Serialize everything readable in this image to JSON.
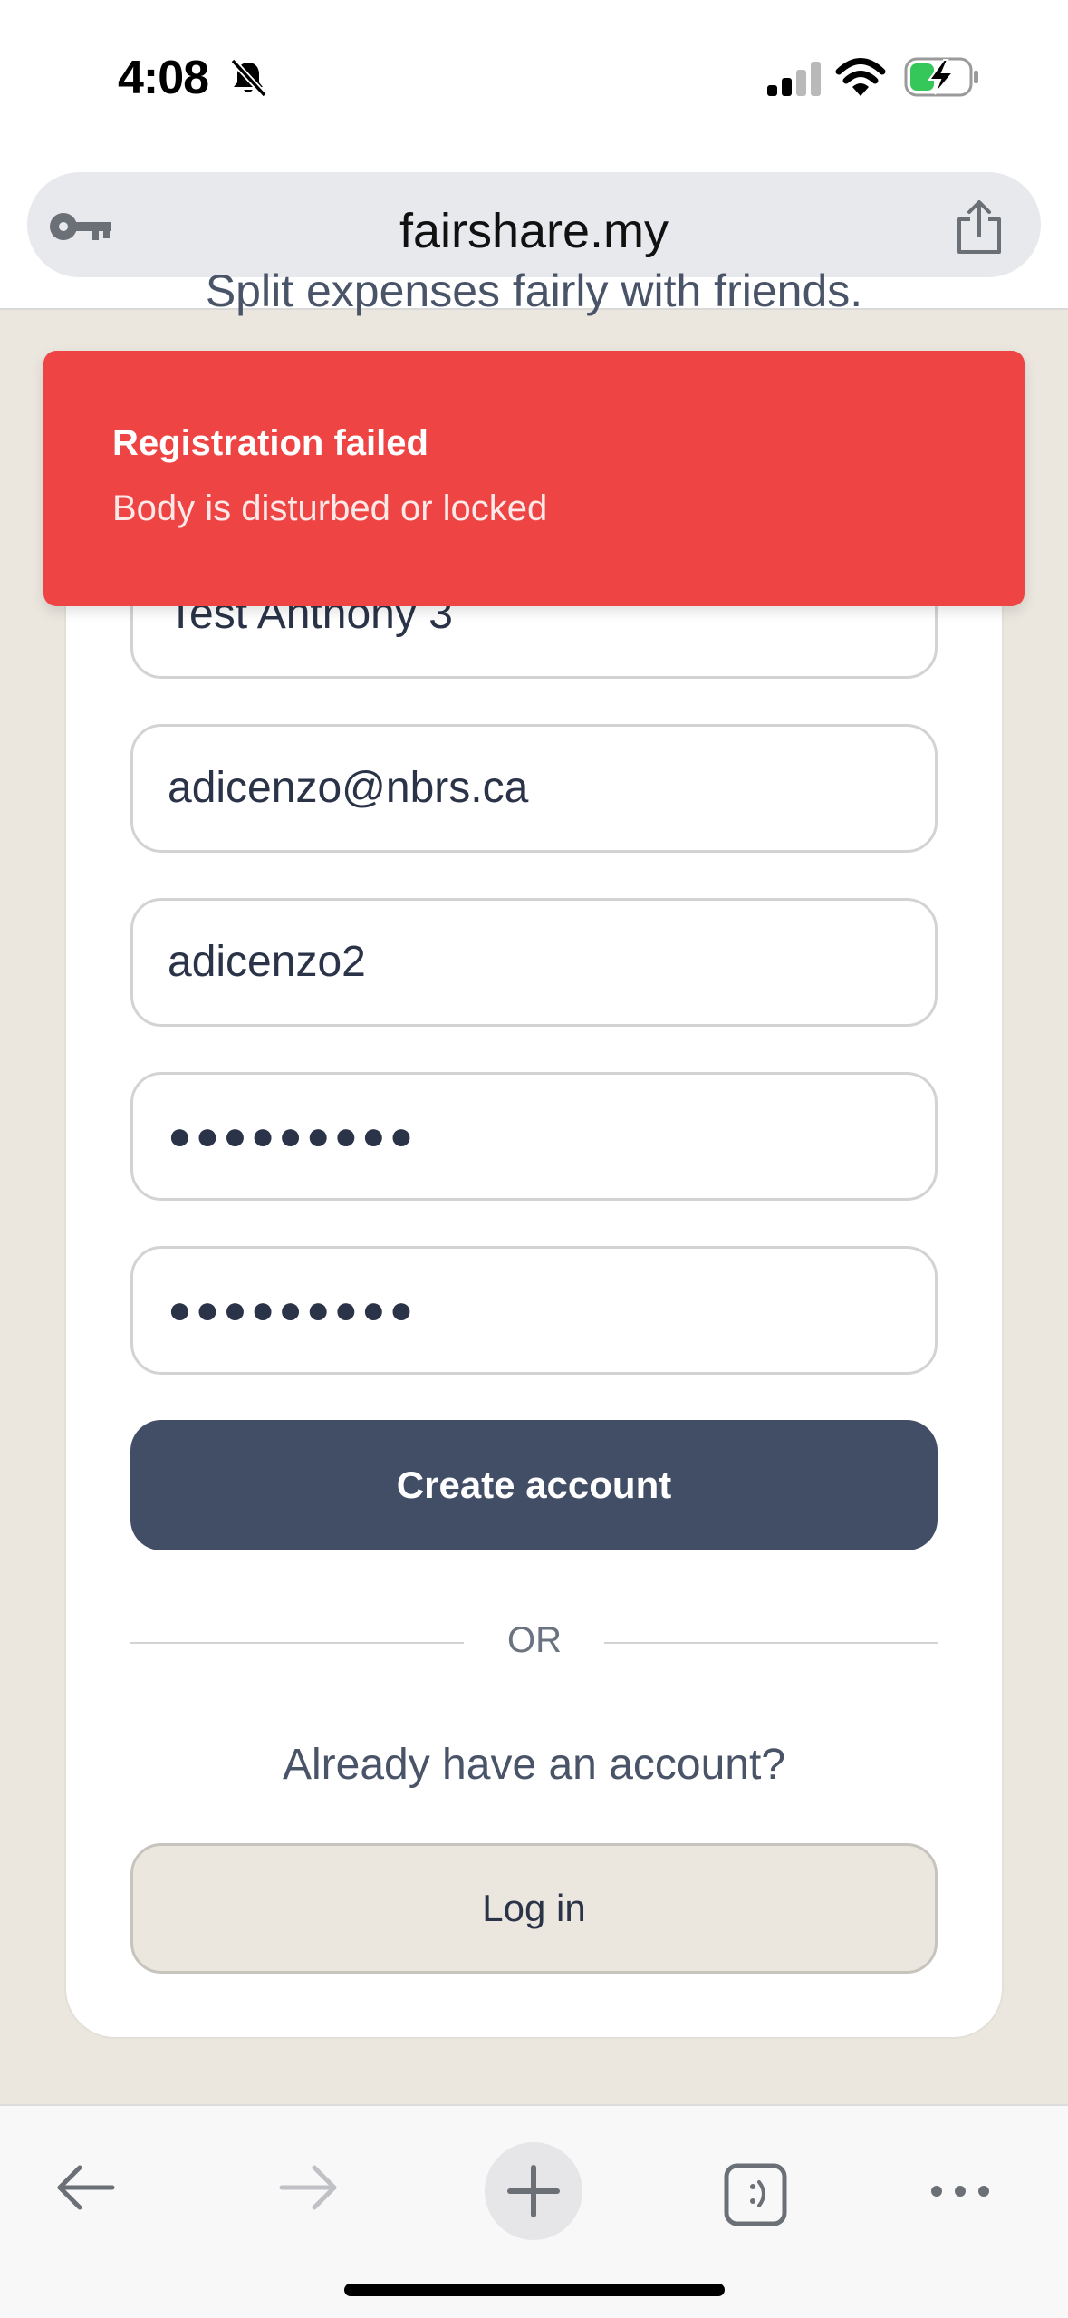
{
  "status_bar": {
    "time": "4:08",
    "icons": [
      "bell-slash-icon",
      "signal-icon",
      "wifi-icon",
      "battery-charging-icon"
    ]
  },
  "browser": {
    "url": "fairshare.my",
    "icons": [
      "key-icon",
      "share-icon"
    ]
  },
  "page": {
    "tagline": "Split expenses fairly with friends.",
    "form": {
      "name_value": "Test Anthony 3",
      "email_value": "adicenzo@nbrs.ca",
      "username_value": "adicenzo2",
      "password_value": "●●●●●●●●●",
      "confirm_password_value": "●●●●●●●●●",
      "create_account_label": "Create account",
      "or_label": "OR",
      "already_text": "Already have an account?",
      "login_label": "Log in"
    }
  },
  "toast": {
    "title": "Registration failed",
    "message": "Body is disturbed or locked",
    "color": "#ef4444"
  },
  "toolbar": {
    "icons": [
      "back-arrow-icon",
      "forward-arrow-icon",
      "plus-icon",
      "tabs-icon",
      "more-icon"
    ]
  },
  "colors": {
    "page_background": "#ebe7df",
    "primary_button": "#424d66",
    "toast_background": "#ef4444"
  }
}
